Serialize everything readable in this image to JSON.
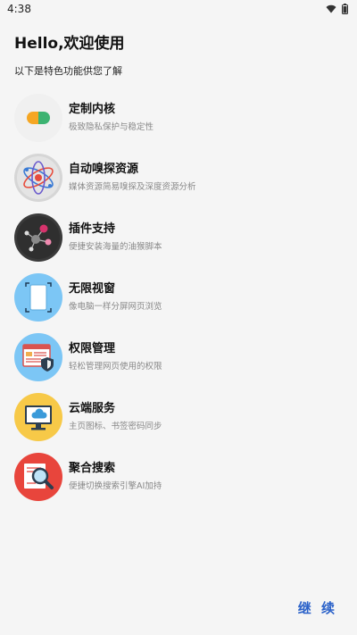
{
  "status_bar": {
    "time": "4:38"
  },
  "header": {
    "greeting": "Hello,欢迎使用",
    "subtitle": "以下是特色功能供您了解"
  },
  "features": [
    {
      "title": "定制内核",
      "desc": "极致隐私保护与稳定性",
      "icon": "kernel-icon"
    },
    {
      "title": "自动嗅探资源",
      "desc": "媒体资源简易嗅探及深度资源分析",
      "icon": "atom-sniff-icon"
    },
    {
      "title": "插件支持",
      "desc": "便捷安装海量的油猴脚本",
      "icon": "plugin-network-icon"
    },
    {
      "title": "无限视窗",
      "desc": "像电脑一样分屏网页浏览",
      "icon": "window-icon"
    },
    {
      "title": "权限管理",
      "desc": "轻松管理网页使用的权限",
      "icon": "shield-permission-icon"
    },
    {
      "title": "云端服务",
      "desc": "主页图标、书签密码同步",
      "icon": "cloud-monitor-icon"
    },
    {
      "title": "聚合搜索",
      "desc": "便捷切换搜索引擎AI加持",
      "icon": "magnifier-search-icon"
    }
  ],
  "footer": {
    "continue_label": "继 续"
  },
  "colors": {
    "accent": "#2b62c9",
    "background": "#f5f5f5"
  }
}
